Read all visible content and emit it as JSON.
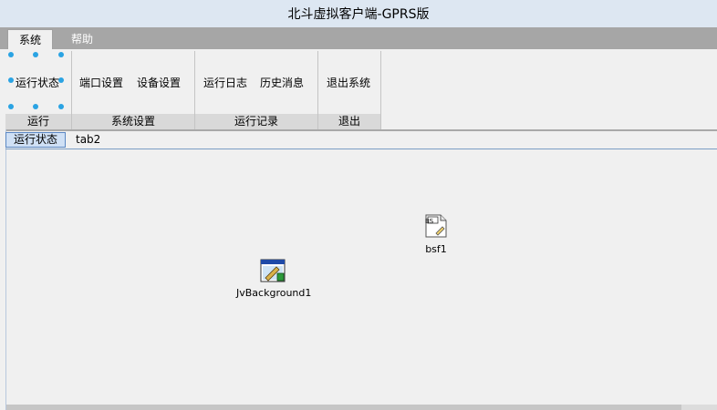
{
  "window": {
    "title": "北斗虚拟客户端-GPRS版"
  },
  "menu": {
    "tabs": [
      "系统",
      "帮助"
    ]
  },
  "ribbon": {
    "groups": [
      {
        "caption": "运行",
        "buttons": [
          "运行状态"
        ]
      },
      {
        "caption": "系统设置",
        "buttons": [
          "端口设置",
          "设备设置"
        ]
      },
      {
        "caption": "运行记录",
        "buttons": [
          "运行日志",
          "历史消息"
        ]
      },
      {
        "caption": "退出",
        "buttons": [
          "退出系统"
        ]
      }
    ]
  },
  "page_tabs": [
    "运行状态",
    "tab2"
  ],
  "components": {
    "bsf": {
      "label": "bsf1",
      "icon": "bs-file-icon",
      "badge": "BS"
    },
    "background": {
      "label": "JvBackground1",
      "icon": "paint-brush-icon"
    }
  },
  "colors": {
    "title_bg": "#dde7f2",
    "menubar_bg": "#a6a6a6",
    "group_caption_bg": "#d9d9d9",
    "selection_dots": "#2aa3e3",
    "active_tab_bg": "#cfe0f5"
  }
}
